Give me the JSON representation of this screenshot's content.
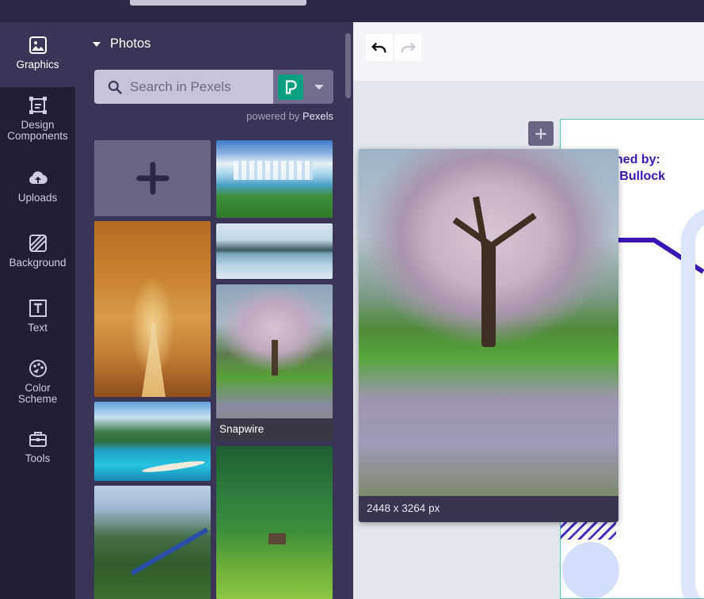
{
  "sidebar": {
    "items": [
      {
        "label": "Graphics",
        "icon": "image-icon",
        "active": true
      },
      {
        "label": "Design\nComponents",
        "icon": "components-icon"
      },
      {
        "label": "Uploads",
        "icon": "cloud-upload-icon"
      },
      {
        "label": "Background",
        "icon": "background-hatch-icon"
      },
      {
        "label": "Text",
        "icon": "text-icon"
      },
      {
        "label": "Color\nScheme",
        "icon": "palette-icon"
      },
      {
        "label": "Tools",
        "icon": "toolbox-icon"
      }
    ]
  },
  "panel": {
    "section_title": "Photos",
    "search": {
      "placeholder": "Search in Pexels",
      "value": ""
    },
    "source_logo": "pexels-logo-icon",
    "powered_by_prefix": "powered by",
    "powered_by_brand": "Pexels",
    "photos": [
      {
        "id": "falls"
      },
      {
        "id": "lake"
      },
      {
        "id": "tree",
        "caption": "Snapwire"
      },
      {
        "id": "forest"
      },
      {
        "id": "autumn"
      },
      {
        "id": "bora"
      },
      {
        "id": "mountain"
      }
    ]
  },
  "preview": {
    "dimensions": "2448 x 3264 px"
  },
  "document": {
    "published_line1": "shed by:",
    "published_line2": "h Bullock"
  },
  "colors": {
    "rail_bg": "#221e36",
    "panel_bg": "#3a3556",
    "pexels_green": "#07a081",
    "accent_purple": "#3a16b5",
    "page_border": "#5bc7b0"
  }
}
